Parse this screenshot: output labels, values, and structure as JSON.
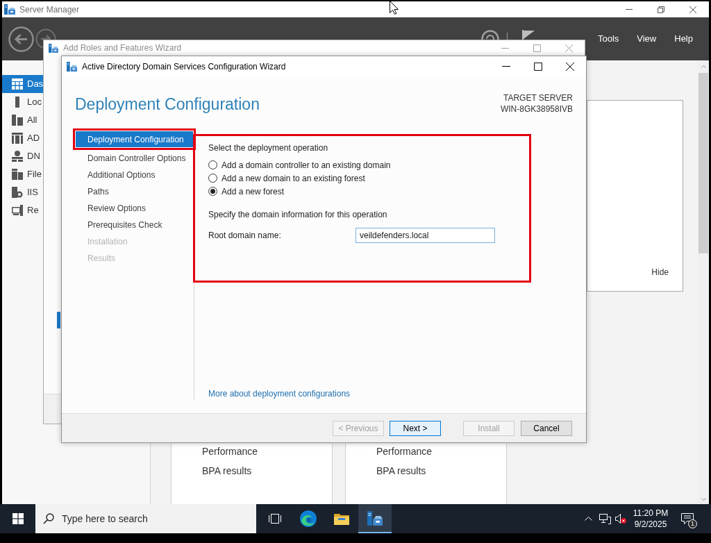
{
  "server_manager": {
    "title": "Server Manager",
    "menu": [
      "Tools",
      "View",
      "Help"
    ],
    "sidebar": [
      {
        "label": "Das",
        "selected": true
      },
      {
        "label": "Loc",
        "selected": false
      },
      {
        "label": "All",
        "selected": false
      },
      {
        "label": "AD",
        "selected": false
      },
      {
        "label": "DN",
        "selected": false
      },
      {
        "label": "File",
        "selected": false
      },
      {
        "label": "IIS",
        "selected": false
      },
      {
        "label": "Re",
        "selected": false
      }
    ],
    "welcome_panel": {
      "hide_link": "Hide"
    },
    "tiles": [
      {
        "rows": [
          "Performance",
          "BPA results"
        ]
      },
      {
        "rows": [
          "Performance",
          "BPA results"
        ]
      }
    ]
  },
  "roles_wizard": {
    "title": "Add Roles and Features Wizard"
  },
  "adds_wizard": {
    "title": "Active Directory Domain Services Configuration Wizard",
    "heading": "Deployment Configuration",
    "target_server": {
      "label": "TARGET SERVER",
      "name": "WIN-8GK38958IVB"
    },
    "steps": [
      {
        "label": "Deployment Configuration",
        "selected": true,
        "disabled": false,
        "highlighted": true
      },
      {
        "label": "Domain Controller Options",
        "selected": false,
        "disabled": false,
        "highlighted": false
      },
      {
        "label": "Additional Options",
        "selected": false,
        "disabled": false,
        "highlighted": false
      },
      {
        "label": "Paths",
        "selected": false,
        "disabled": false,
        "highlighted": false
      },
      {
        "label": "Review Options",
        "selected": false,
        "disabled": false,
        "highlighted": false
      },
      {
        "label": "Prerequisites Check",
        "selected": false,
        "disabled": false,
        "highlighted": false
      },
      {
        "label": "Installation",
        "selected": false,
        "disabled": true,
        "highlighted": false
      },
      {
        "label": "Results",
        "selected": false,
        "disabled": true,
        "highlighted": false
      }
    ],
    "operation_panel": {
      "highlighted": true,
      "title": "Select the deployment operation",
      "options": [
        {
          "label": "Add a domain controller to an existing domain",
          "selected": false
        },
        {
          "label": "Add a new domain to an existing forest",
          "selected": false
        },
        {
          "label": "Add a new forest",
          "selected": true
        }
      ],
      "domain_title": "Specify the domain information for this operation",
      "root_domain": {
        "label": "Root domain name:",
        "value": "veildefenders.local"
      }
    },
    "link": "More about deployment configurations",
    "buttons": [
      {
        "label": "< Previous",
        "disabled": true,
        "default": false
      },
      {
        "label": "Next >",
        "disabled": false,
        "default": true
      },
      {
        "label": "Install",
        "disabled": true,
        "default": false
      },
      {
        "label": "Cancel",
        "disabled": false,
        "default": false
      }
    ]
  },
  "taskbar": {
    "search": {
      "placeholder": "Type here to search"
    },
    "apps": [
      {
        "kind": "taskview",
        "active": false
      },
      {
        "kind": "browser",
        "active": false
      },
      {
        "kind": "folder",
        "active": false
      },
      {
        "kind": "server",
        "active": true
      }
    ],
    "time": "11:20 PM",
    "date": "9/2/2025",
    "notification_count": "1"
  }
}
